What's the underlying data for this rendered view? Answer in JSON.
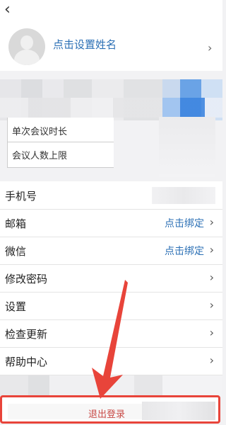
{
  "header": {
    "back_icon": "chevron-left-icon"
  },
  "profile": {
    "name_prompt": "点击设置姓名"
  },
  "meeting": {
    "duration_label": "单次会议时长",
    "limit_label": "会议人数上限"
  },
  "settings": {
    "rows": [
      {
        "label": "手机号",
        "value": ""
      },
      {
        "label": "邮箱",
        "value": "点击绑定"
      },
      {
        "label": "微信",
        "value": "点击绑定"
      },
      {
        "label": "修改密码",
        "value": ""
      },
      {
        "label": "设置",
        "value": ""
      },
      {
        "label": "检查更新",
        "value": ""
      },
      {
        "label": "帮助中心",
        "value": ""
      }
    ]
  },
  "logout": {
    "label": "退出登录"
  },
  "annotation": {
    "color": "#e8443a",
    "accent": "#2c70b5"
  }
}
